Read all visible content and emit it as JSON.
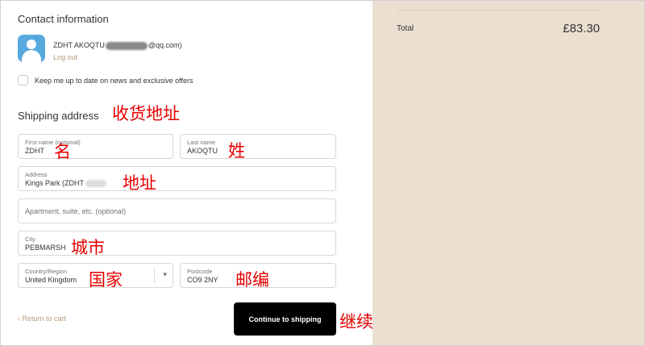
{
  "contact": {
    "title": "Contact information",
    "email_prefix": "ZDHT AKOQTU",
    "email_suffix": "@qq.com)",
    "logout": "Log out",
    "newsletter_label": "Keep me up to date on news and exclusive offers"
  },
  "shipping": {
    "title": "Shipping address",
    "first_name": {
      "label": "First name (optional)",
      "value": "ZDHT"
    },
    "last_name": {
      "label": "Last name",
      "value": "AKOQTU"
    },
    "address": {
      "label": "Address",
      "value": "Kings Park (ZDHT"
    },
    "apartment": {
      "placeholder": "Apartment, suite, etc. (optional)"
    },
    "city": {
      "label": "City",
      "value": "PEBMARSH"
    },
    "country": {
      "label": "Country/Region",
      "value": "United Kingdom"
    },
    "postcode": {
      "label": "Postcode",
      "value": "CO9 2NY"
    }
  },
  "actions": {
    "return": "Return to cart",
    "continue": "Continue to shipping"
  },
  "summary": {
    "total_label": "Total",
    "total_value": "£83.30"
  },
  "annotations": {
    "shipping_address": "收货地址",
    "first_name": "名",
    "last_name": "姓",
    "address": "地址",
    "city": "城市",
    "country": "国家",
    "postcode": "邮编",
    "continue": "继续"
  }
}
